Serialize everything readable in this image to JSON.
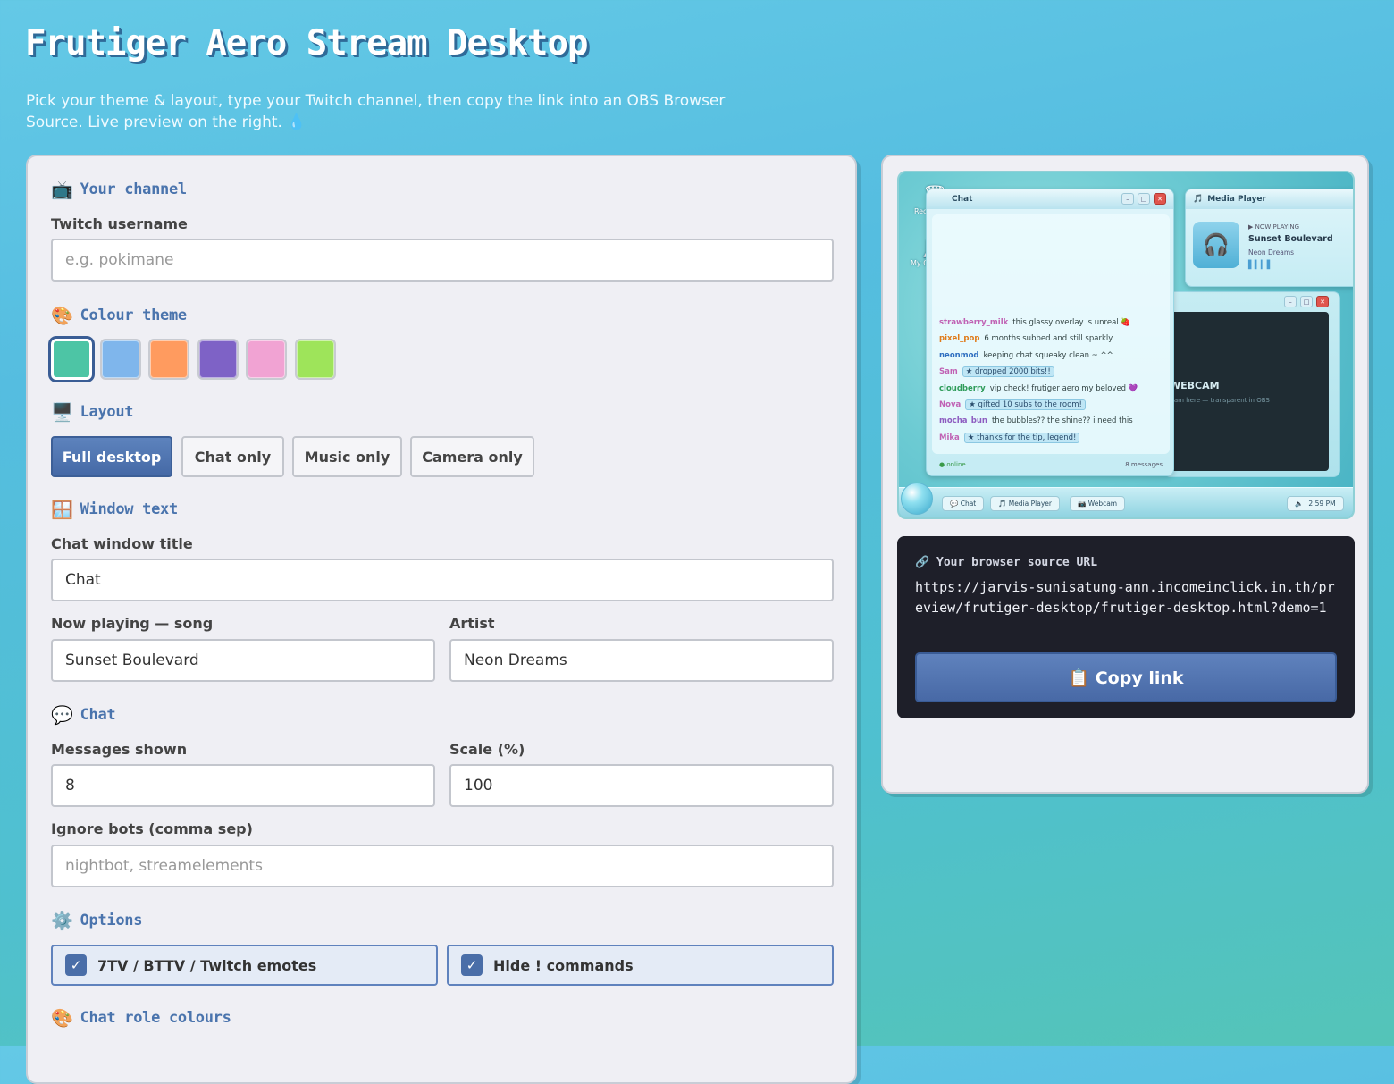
{
  "header": {
    "title": "Frutiger Aero Stream Desktop",
    "subtitle": "Pick your theme & layout, type your Twitch channel, then copy the link into an OBS Browser Source. Live preview on the right. 💧"
  },
  "form": {
    "channel": {
      "section_icon": "📺",
      "section_title": "Your channel",
      "label": "Twitch username",
      "placeholder": "e.g. pokimane",
      "value": ""
    },
    "theme": {
      "section_icon": "🎨",
      "section_title": "Colour theme",
      "swatches": [
        "#4dc5a5",
        "#7fb6ec",
        "#ff9b5f",
        "#7e62c6",
        "#f1a3d3",
        "#9ee45a"
      ],
      "selected_index": 0
    },
    "layout": {
      "section_icon": "🖥️",
      "section_title": "Layout",
      "options": [
        "Full desktop",
        "Chat only",
        "Music only",
        "Camera only"
      ],
      "selected": "Full desktop"
    },
    "window_text": {
      "section_icon": "🪟",
      "section_title": "Window text",
      "chat_title_label": "Chat window title",
      "chat_title_value": "Chat",
      "song_label": "Now playing — song",
      "song_value": "Sunset Boulevard",
      "artist_label": "Artist",
      "artist_value": "Neon Dreams"
    },
    "chat": {
      "section_icon": "💬",
      "section_title": "Chat",
      "messages_label": "Messages shown",
      "messages_value": "8",
      "scale_label": "Scale (%)",
      "scale_value": "100",
      "ignore_label": "Ignore bots (comma sep)",
      "ignore_placeholder": "nightbot, streamelements"
    },
    "options": {
      "section_icon": "⚙️",
      "section_title": "Options",
      "emotes_label": "7TV / BTTV / Twitch emotes",
      "emotes_checked": true,
      "hide_label": "Hide ! commands",
      "hide_checked": true
    },
    "role_colours": {
      "section_icon": "🎨",
      "section_title": "Chat role colours"
    }
  },
  "preview": {
    "desktop_icons": [
      "Recycle Bin",
      "My Computer"
    ],
    "chat_window": {
      "title": "Chat",
      "messages": [
        {
          "user": "strawberry_milk",
          "color": "#c062b4",
          "text": "this glassy overlay is unreal 🍓"
        },
        {
          "user": "pixel_pop",
          "color": "#e07b1a",
          "text": "6 months subbed and still sparkly"
        },
        {
          "user": "neonmod",
          "color": "#2f6fc0",
          "text": "keeping chat squeaky clean ~ ^^"
        },
        {
          "user": "Sam",
          "color": "#c062b4",
          "event": "★ dropped 2000 bits!!"
        },
        {
          "user": "cloudberry",
          "color": "#2f9c5a",
          "text": "vip check! frutiger aero my beloved 💜"
        },
        {
          "user": "Nova",
          "color": "#c062b4",
          "event": "★ gifted 10 subs to the room!"
        },
        {
          "user": "mocha_bun",
          "color": "#8d5cc0",
          "text": "the bubbles?? the shine?? i need this"
        },
        {
          "user": "Mika",
          "color": "#c062b4",
          "event": "★ thanks for the tip, legend!"
        }
      ],
      "status": "● online",
      "count": "8 messages"
    },
    "media_window": {
      "title": "Media Player",
      "now_playing_label": "▶ NOW PLAYING",
      "song": "Sunset Boulevard",
      "artist": "Neon Dreams"
    },
    "cam_window": {
      "label": "WEBCAM",
      "hint": "Cam here — transparent in OBS"
    },
    "taskbar": {
      "items": [
        "💬 Chat",
        "🎵 Media Player",
        "📷 Webcam"
      ],
      "clock": "2:59 PM"
    }
  },
  "url_box": {
    "title": "🔗 Your browser source URL",
    "url": "https://jarvis-sunisatung-ann.incomeinclick.in.th/preview/frutiger-desktop/frutiger-desktop.html?demo=1",
    "copy_label": "📋 Copy link"
  }
}
